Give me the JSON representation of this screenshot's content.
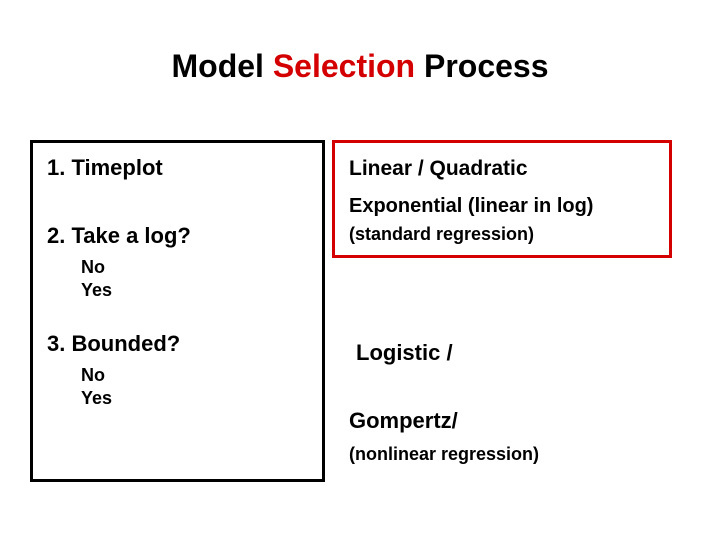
{
  "title": {
    "part1": "Model ",
    "part2_red": "Selection",
    "part3": " Process"
  },
  "left": {
    "step1": "1. Timeplot",
    "step2": "2. Take a log?",
    "step2_no": "No",
    "step2_yes": "Yes",
    "step3": "3. Bounded?",
    "step3_no": "No",
    "step3_yes": "Yes"
  },
  "right": {
    "line1": "Linear / Quadratic",
    "line2": "Exponential (linear in log)",
    "line3": "(standard regression)"
  },
  "logistic": "Logistic /",
  "gompertz": "Gompertz/",
  "nonlin": "(nonlinear regression)"
}
